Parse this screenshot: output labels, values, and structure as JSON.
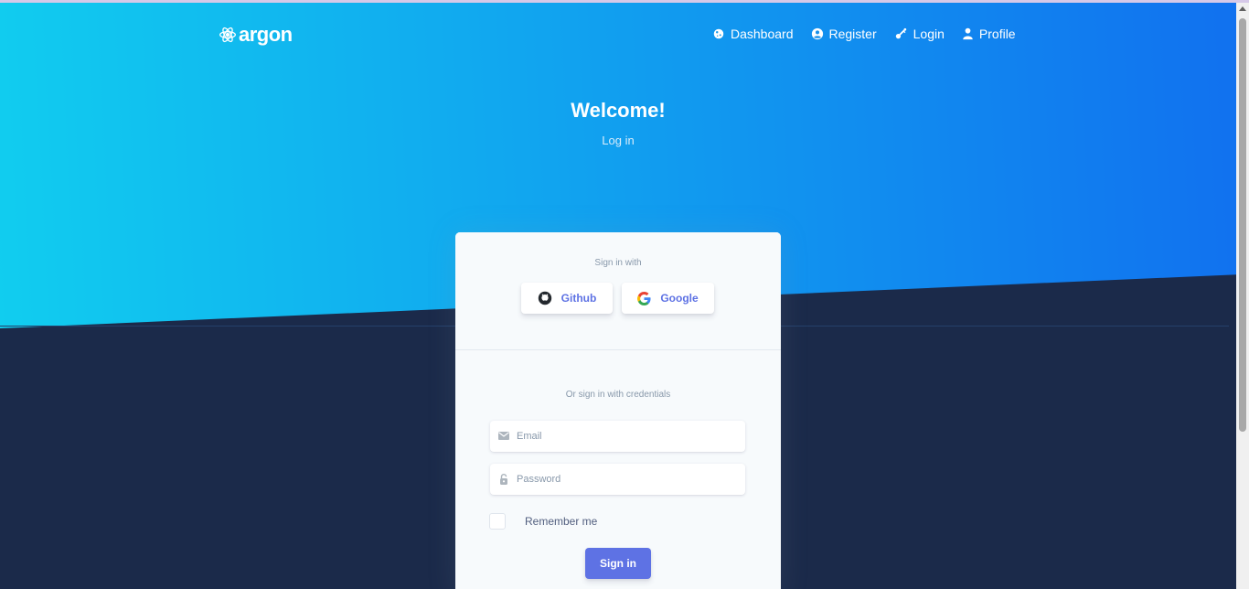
{
  "brand": {
    "name": "argon",
    "icon": "atom-icon"
  },
  "nav": {
    "items": [
      {
        "label": "Dashboard",
        "icon": "planet-icon"
      },
      {
        "label": "Register",
        "icon": "user-circle-icon"
      },
      {
        "label": "Login",
        "icon": "key-icon"
      },
      {
        "label": "Profile",
        "icon": "user-icon"
      }
    ]
  },
  "hero": {
    "title": "Welcome!",
    "subtitle": "Log in"
  },
  "card": {
    "social_label": "Sign in with",
    "github_label": "Github",
    "google_label": "Google",
    "credentials_label": "Or sign in with credentials",
    "email_placeholder": "Email",
    "password_placeholder": "Password",
    "remember_label": "Remember me",
    "signin_label": "Sign in"
  },
  "colors": {
    "gradient_start": "#11cdef",
    "gradient_end": "#1171ef",
    "primary": "#5e72e4",
    "dark_bg": "#1b2a4a"
  }
}
